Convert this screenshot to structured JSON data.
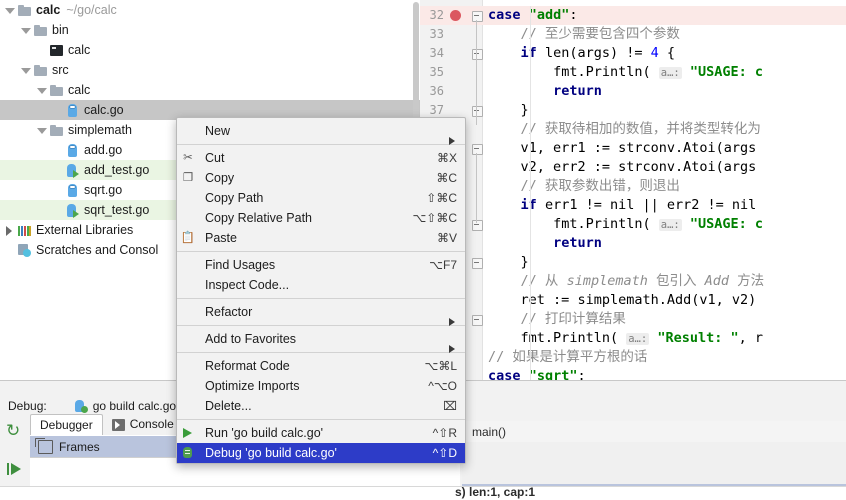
{
  "project_tree": {
    "rows": [
      {
        "label": "calc",
        "path": "~/go/calc",
        "indent": 0,
        "twisty": "down",
        "icon": "folder-icon",
        "bold": true,
        "state": "normal"
      },
      {
        "label": "bin",
        "path": "",
        "indent": 1,
        "twisty": "down",
        "icon": "folder-icon",
        "bold": false,
        "state": "normal"
      },
      {
        "label": "calc",
        "path": "",
        "indent": 2,
        "twisty": "none",
        "icon": "binary-icon",
        "bold": false,
        "state": "normal"
      },
      {
        "label": "src",
        "path": "",
        "indent": 1,
        "twisty": "down",
        "icon": "folder-icon",
        "bold": false,
        "state": "normal"
      },
      {
        "label": "calc",
        "path": "",
        "indent": 2,
        "twisty": "down",
        "icon": "folder-icon",
        "bold": false,
        "state": "normal"
      },
      {
        "label": "calc.go",
        "path": "",
        "indent": 3,
        "twisty": "none",
        "icon": "go-file-icon",
        "bold": false,
        "state": "selected"
      },
      {
        "label": "simplemath",
        "path": "",
        "indent": 2,
        "twisty": "down",
        "icon": "folder-icon",
        "bold": false,
        "state": "normal"
      },
      {
        "label": "add.go",
        "path": "",
        "indent": 3,
        "twisty": "none",
        "icon": "go-file-icon",
        "bold": false,
        "state": "normal"
      },
      {
        "label": "add_test.go",
        "path": "",
        "indent": 3,
        "twisty": "none",
        "icon": "go-test-file-icon",
        "bold": false,
        "state": "modified"
      },
      {
        "label": "sqrt.go",
        "path": "",
        "indent": 3,
        "twisty": "none",
        "icon": "go-file-icon",
        "bold": false,
        "state": "normal"
      },
      {
        "label": "sqrt_test.go",
        "path": "",
        "indent": 3,
        "twisty": "none",
        "icon": "go-test-file-icon",
        "bold": false,
        "state": "modified"
      },
      {
        "label": "External Libraries",
        "path": "",
        "indent": 0,
        "twisty": "right",
        "icon": "external-libraries-icon",
        "bold": false,
        "state": "normal"
      },
      {
        "label": "Scratches and Consol",
        "path": "",
        "indent": 0,
        "twisty": "none",
        "icon": "scratches-icon",
        "bold": false,
        "state": "normal"
      }
    ]
  },
  "context_menu": {
    "groups": [
      {
        "items": [
          {
            "label": "New",
            "accel": "",
            "icon": "",
            "submenu": true,
            "selected": false
          }
        ]
      },
      {
        "items": [
          {
            "label": "Cut",
            "accel": "⌘X",
            "icon": "scissors-icon",
            "submenu": false,
            "selected": false
          },
          {
            "label": "Copy",
            "accel": "⌘C",
            "icon": "copy-icon",
            "submenu": false,
            "selected": false
          },
          {
            "label": "Copy Path",
            "accel": "⇧⌘C",
            "icon": "",
            "submenu": false,
            "selected": false
          },
          {
            "label": "Copy Relative Path",
            "accel": "⌥⇧⌘C",
            "icon": "",
            "submenu": false,
            "selected": false
          },
          {
            "label": "Paste",
            "accel": "⌘V",
            "icon": "paste-icon",
            "submenu": false,
            "selected": false
          }
        ]
      },
      {
        "items": [
          {
            "label": "Find Usages",
            "accel": "⌥F7",
            "icon": "",
            "submenu": false,
            "selected": false
          },
          {
            "label": "Inspect Code...",
            "accel": "",
            "icon": "",
            "submenu": false,
            "selected": false
          }
        ]
      },
      {
        "items": [
          {
            "label": "Refactor",
            "accel": "",
            "icon": "",
            "submenu": true,
            "selected": false
          }
        ]
      },
      {
        "items": [
          {
            "label": "Add to Favorites",
            "accel": "",
            "icon": "",
            "submenu": true,
            "selected": false
          }
        ]
      },
      {
        "items": [
          {
            "label": "Reformat Code",
            "accel": "⌥⌘L",
            "icon": "",
            "submenu": false,
            "selected": false
          },
          {
            "label": "Optimize Imports",
            "accel": "^⌥O",
            "icon": "",
            "submenu": false,
            "selected": false
          },
          {
            "label": "Delete...",
            "accel": "⌧",
            "icon": "",
            "submenu": false,
            "selected": false
          }
        ]
      },
      {
        "items": [
          {
            "label": "Run 'go build calc.go'",
            "accel": "^⇧R",
            "icon": "run-icon",
            "submenu": false,
            "selected": false
          },
          {
            "label": "Debug 'go build calc.go'",
            "accel": "^⇧D",
            "icon": "debug-icon",
            "submenu": false,
            "selected": true
          }
        ]
      }
    ]
  },
  "editor": {
    "line_numbers": [
      "32",
      "33",
      "34",
      "35",
      "36",
      "37"
    ],
    "breakpoint_line": "32",
    "lines": [
      {
        "num": "32",
        "highlight": true,
        "indent": 8,
        "tokens": [
          {
            "t": "case",
            "c": "k"
          },
          {
            "t": " ",
            "c": ""
          },
          {
            "t": "\"add\"",
            "c": "s"
          },
          {
            "t": ":",
            "c": ""
          }
        ]
      },
      {
        "num": "33",
        "highlight": false,
        "indent": 12,
        "tokens": [
          {
            "t": "// 至少需要包含四个参数",
            "c": "c"
          }
        ]
      },
      {
        "num": "34",
        "highlight": false,
        "indent": 12,
        "tokens": [
          {
            "t": "if",
            "c": "k"
          },
          {
            "t": " len(args) != ",
            "c": ""
          },
          {
            "t": "4",
            "c": "n"
          },
          {
            "t": " {",
            "c": ""
          }
        ]
      },
      {
        "num": "35",
        "highlight": false,
        "indent": 16,
        "tokens": [
          {
            "t": "fmt.Println( ",
            "c": ""
          },
          {
            "t": "a…:",
            "c": "hint"
          },
          {
            "t": " ",
            "c": ""
          },
          {
            "t": "\"USAGE: c",
            "c": "s"
          }
        ]
      },
      {
        "num": "36",
        "highlight": false,
        "indent": 16,
        "tokens": [
          {
            "t": "return",
            "c": "k"
          }
        ]
      },
      {
        "num": "37",
        "highlight": false,
        "indent": 12,
        "tokens": [
          {
            "t": "}",
            "c": ""
          }
        ]
      },
      {
        "num": "",
        "highlight": false,
        "indent": 12,
        "tokens": [
          {
            "t": "// 获取待相加的数值，并将类型转化为",
            "c": "c"
          }
        ]
      },
      {
        "num": "",
        "highlight": false,
        "indent": 12,
        "tokens": [
          {
            "t": "v1, err1 := strconv.Atoi(args",
            "c": ""
          }
        ]
      },
      {
        "num": "",
        "highlight": false,
        "indent": 12,
        "tokens": [
          {
            "t": "v2, err2 := strconv.Atoi(args",
            "c": ""
          }
        ]
      },
      {
        "num": "",
        "highlight": false,
        "indent": 12,
        "tokens": [
          {
            "t": "// 获取参数出错，则退出",
            "c": "c"
          }
        ]
      },
      {
        "num": "",
        "highlight": false,
        "indent": 12,
        "tokens": [
          {
            "t": "if",
            "c": "k"
          },
          {
            "t": " err1 != nil || err2 != nil",
            "c": ""
          }
        ]
      },
      {
        "num": "",
        "highlight": false,
        "indent": 16,
        "tokens": [
          {
            "t": "fmt.Println( ",
            "c": ""
          },
          {
            "t": "a…:",
            "c": "hint"
          },
          {
            "t": " ",
            "c": ""
          },
          {
            "t": "\"USAGE: c",
            "c": "s"
          }
        ]
      },
      {
        "num": "",
        "highlight": false,
        "indent": 16,
        "tokens": [
          {
            "t": "return",
            "c": "k"
          }
        ]
      },
      {
        "num": "",
        "highlight": false,
        "indent": 12,
        "tokens": [
          {
            "t": "}",
            "c": ""
          }
        ]
      },
      {
        "num": "",
        "highlight": false,
        "indent": 12,
        "tokens": [
          {
            "t": "// 从 ",
            "c": "c"
          },
          {
            "t": "simplemath",
            "c": "ci"
          },
          {
            "t": " 包引入 ",
            "c": "c"
          },
          {
            "t": "Add",
            "c": "ci"
          },
          {
            "t": " 方法",
            "c": "c"
          }
        ]
      },
      {
        "num": "",
        "highlight": false,
        "indent": 12,
        "tokens": [
          {
            "t": "ret := simplemath.Add(v1, v2)",
            "c": ""
          }
        ]
      },
      {
        "num": "",
        "highlight": false,
        "indent": 12,
        "tokens": [
          {
            "t": "// 打印计算结果",
            "c": "c"
          }
        ]
      },
      {
        "num": "",
        "highlight": false,
        "indent": 12,
        "tokens": [
          {
            "t": "fmt.Println( ",
            "c": ""
          },
          {
            "t": "a…:",
            "c": "hint"
          },
          {
            "t": " ",
            "c": ""
          },
          {
            "t": "\"Result: \"",
            "c": "s"
          },
          {
            "t": ", r",
            "c": ""
          }
        ]
      },
      {
        "num": "",
        "highlight": false,
        "indent": 8,
        "tokens": [
          {
            "t": "// 如果是计算平方根的话",
            "c": "c"
          }
        ]
      },
      {
        "num": "",
        "highlight": false,
        "indent": 8,
        "tokens": [
          {
            "t": "case",
            "c": "k"
          },
          {
            "t": " ",
            "c": ""
          },
          {
            "t": "\"sqrt\"",
            "c": "s"
          },
          {
            "t": ":",
            "c": ""
          }
        ]
      }
    ]
  },
  "debug_panel": {
    "header_label": "Debug:",
    "config_name": "go build calc.go",
    "tabs": [
      {
        "label": "Debugger",
        "active": true,
        "icon": ""
      },
      {
        "label": "Console",
        "active": false,
        "icon": "console-icon"
      },
      {
        "label": "→¹",
        "active": false,
        "icon": ""
      }
    ],
    "frames_label": "Frames",
    "toolbar_buttons": [
      {
        "name": "rerun-icon"
      },
      {
        "name": "resume-program-icon"
      }
    ],
    "variables": [
      {
        "label": "main()",
        "kind": "frame"
      },
      {
        "label": "",
        "kind": "blank"
      },
      {
        "label": "",
        "kind": "blank"
      },
      {
        "label": "",
        "kind": "selected"
      }
    ],
    "bottom_text": "s) len:1, cap:1"
  },
  "colors": {
    "selection_blue": "#2d3cc8",
    "tree_selection": "#c6c6c6",
    "modified_row": "#eaf5e3",
    "breakpoint_red": "#db5860",
    "highlight_line": "#fbe9e7",
    "frames_selection": "#b9c4dd",
    "string_green": "#008000",
    "keyword_navy": "#000080"
  }
}
